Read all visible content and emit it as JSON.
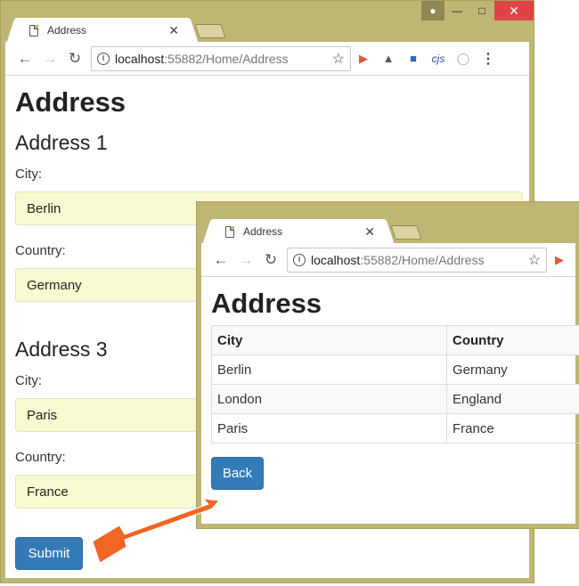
{
  "form_window": {
    "tab_title": "Address",
    "url_host": "localhost",
    "url_rest": ":55882/Home/Address",
    "page_title": "Address",
    "address1": {
      "heading": "Address 1",
      "city_label": "City:",
      "city_value": "Berlin",
      "country_label": "Country:",
      "country_value": "Germany"
    },
    "address3": {
      "heading": "Address 3",
      "city_label": "City:",
      "city_value": "Paris",
      "country_label": "Country:",
      "country_value": "France"
    },
    "submit_label": "Submit"
  },
  "result_window": {
    "tab_title": "Address",
    "url_host": "localhost",
    "url_rest": ":55882/Home/Address",
    "page_title": "Address",
    "table": {
      "headers": [
        "City",
        "Country"
      ],
      "rows": [
        [
          "Berlin",
          "Germany"
        ],
        [
          "London",
          "England"
        ],
        [
          "Paris",
          "France"
        ]
      ]
    },
    "back_label": "Back"
  },
  "icons": {
    "user": "user-icon",
    "minimize": "minimize-icon",
    "maximize": "maximize-icon",
    "close": "close-icon",
    "back": "back-arrow-icon",
    "forward": "forward-arrow-icon",
    "reload": "reload-icon",
    "info": "info-icon",
    "star": "star-icon"
  },
  "colors": {
    "frame": "#bfb673",
    "button": "#337ab7",
    "autofill": "#fafad2",
    "arrow": "#f26522"
  }
}
